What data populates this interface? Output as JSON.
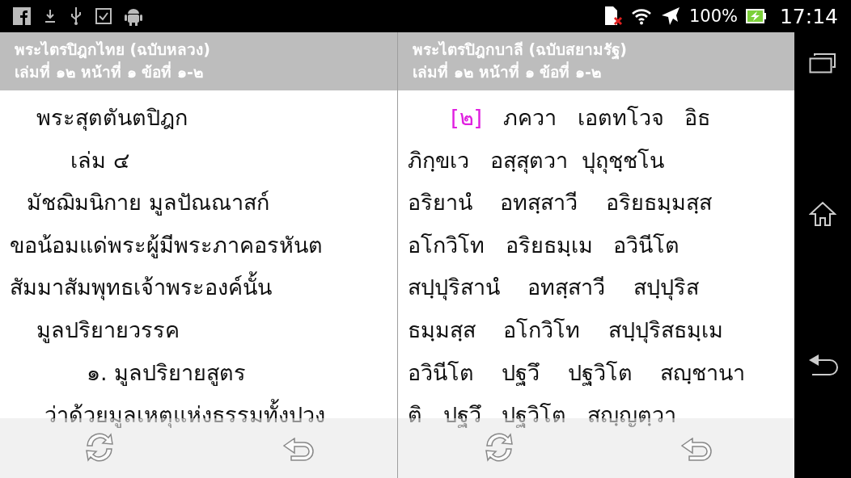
{
  "status_bar": {
    "battery": "100%",
    "time": "17:14"
  },
  "panes": [
    {
      "title": "พระไตรปิฎกไทย (ฉบับหลวง)",
      "subtitle": "เล่มที่ ๑๒ หน้าที่ ๑ ข้อที่ ๑-๒",
      "lines": [
        {
          "text": "พระสุตตันตปิฎก"
        },
        {
          "text": "เล่ม ๔"
        },
        {
          "text": "มัชฌิมนิกาย มูลปัณณาสก์"
        },
        {
          "text": "ขอน้อมแด่พระผู้มีพระภาคอรหันต"
        },
        {
          "text": "สัมมาสัมพุทธเจ้าพระองค์นั้น"
        },
        {
          "text": "มูลปริยายวรรค"
        },
        {
          "text": "๑. มูลปริยายสูตร"
        },
        {
          "text": "ว่าด้วยมูลเหตุแห่งธรรมทั้งปวง"
        }
      ]
    },
    {
      "title": "พระไตรปิฎกบาลี (ฉบับสยามรัฐ)",
      "subtitle": "เล่มที่ ๑๒ หน้าที่ ๑ ข้อที่ ๑-๒",
      "lines": [
        {
          "ref": "[๒]",
          "text": "ภควา   เอตทโวจ   อิธ"
        },
        {
          "text": "ภิกฺขเว   อสฺสุตวา  ปุถุชฺชโน"
        },
        {
          "text": "อริยานํ    อทสฺสาวี    อริยธมฺมสฺส"
        },
        {
          "text": "อโกวิโท   อริยธมฺเม   อวินีโต"
        },
        {
          "text": "สปฺปุริสานํ    อทสฺสาวี    สปฺปุริส"
        },
        {
          "text": "ธมฺมสฺส    อโกวิโท    สปฺปุริสธมฺเม"
        },
        {
          "text": "อวินีโต    ปฐวึ    ปฐวิโต    สญฺชานา"
        },
        {
          "text": "ติ   ปฐวึ   ปฐวิโต   สญฺญตฺวา"
        }
      ]
    }
  ]
}
